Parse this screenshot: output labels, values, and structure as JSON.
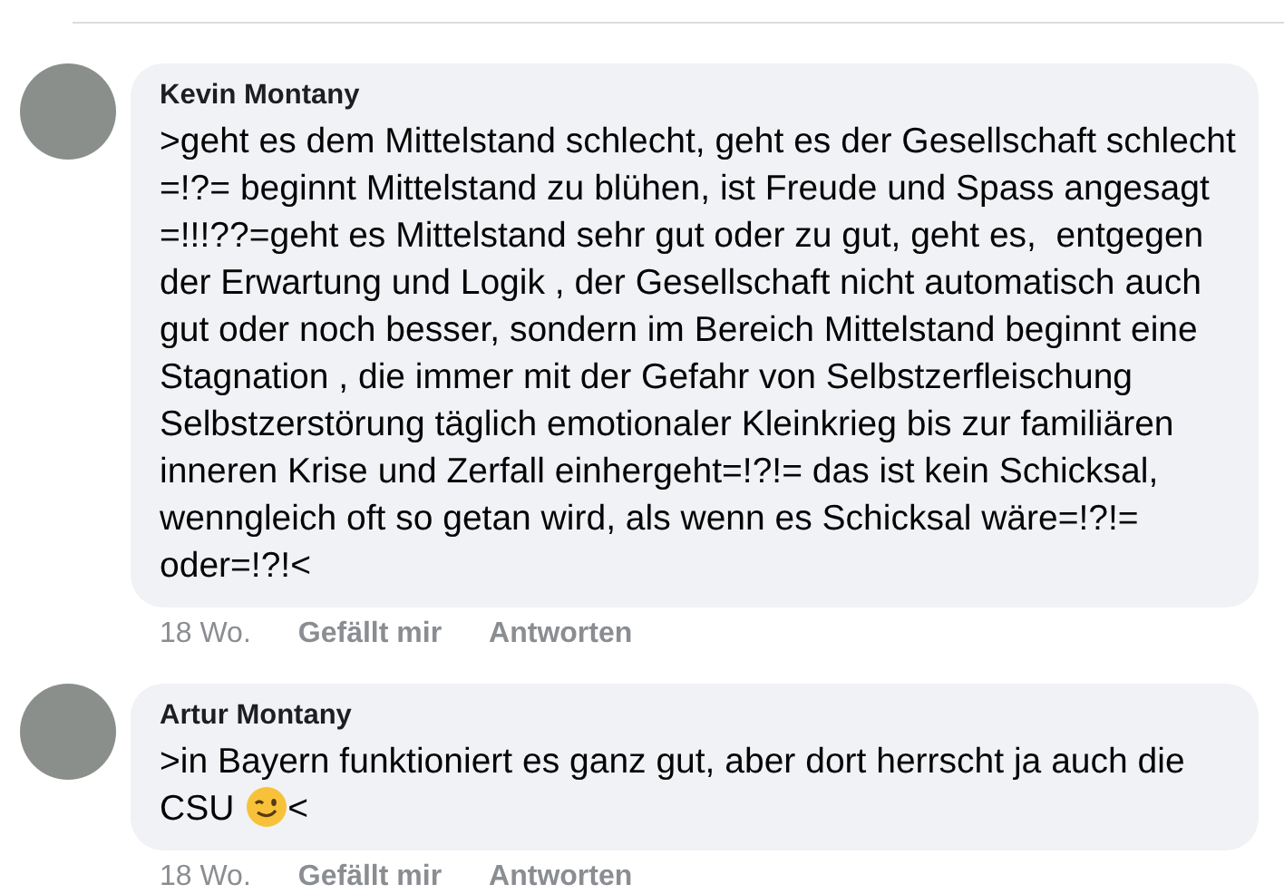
{
  "comments": [
    {
      "author": "Kevin Montany",
      "body": [
        {
          "kind": "text",
          "text": ">geht es dem Mittelstand schlecht, geht es der Gesellschaft schlecht =!?= beginnt Mittelstand zu blühen, ist Freude und Spass angesagt  =!!!??=geht es Mittelstand sehr gut oder zu gut, geht es,  entgegen der Erwartung und Logik , der Gesellschaft nicht automatisch auch gut oder noch besser, sondern im Bereich Mittelstand beginnt eine Stagnation , die immer mit der Gefahr von Selbstzerfleischung  Selbstzerstörung täglich emotionaler Kleinkrieg bis zur familiären inneren Krise und Zerfall einhergeht=!?!= das ist kein Schicksal, wenngleich oft so getan wird, als wenn es Schicksal wäre=!?!= oder=!?!<"
        }
      ],
      "time": "18 Wo.",
      "like": "Gefällt mir",
      "reply": "Antworten"
    },
    {
      "author": "Artur Montany",
      "body": [
        {
          "kind": "text",
          "text": ">in Bayern funktioniert es ganz gut, aber dort herrscht ja auch die CSU "
        },
        {
          "kind": "emoji"
        },
        {
          "kind": "text",
          "text": "<"
        }
      ],
      "time": "18 Wo.",
      "like": "Gefällt mir",
      "reply": "Antworten"
    }
  ]
}
